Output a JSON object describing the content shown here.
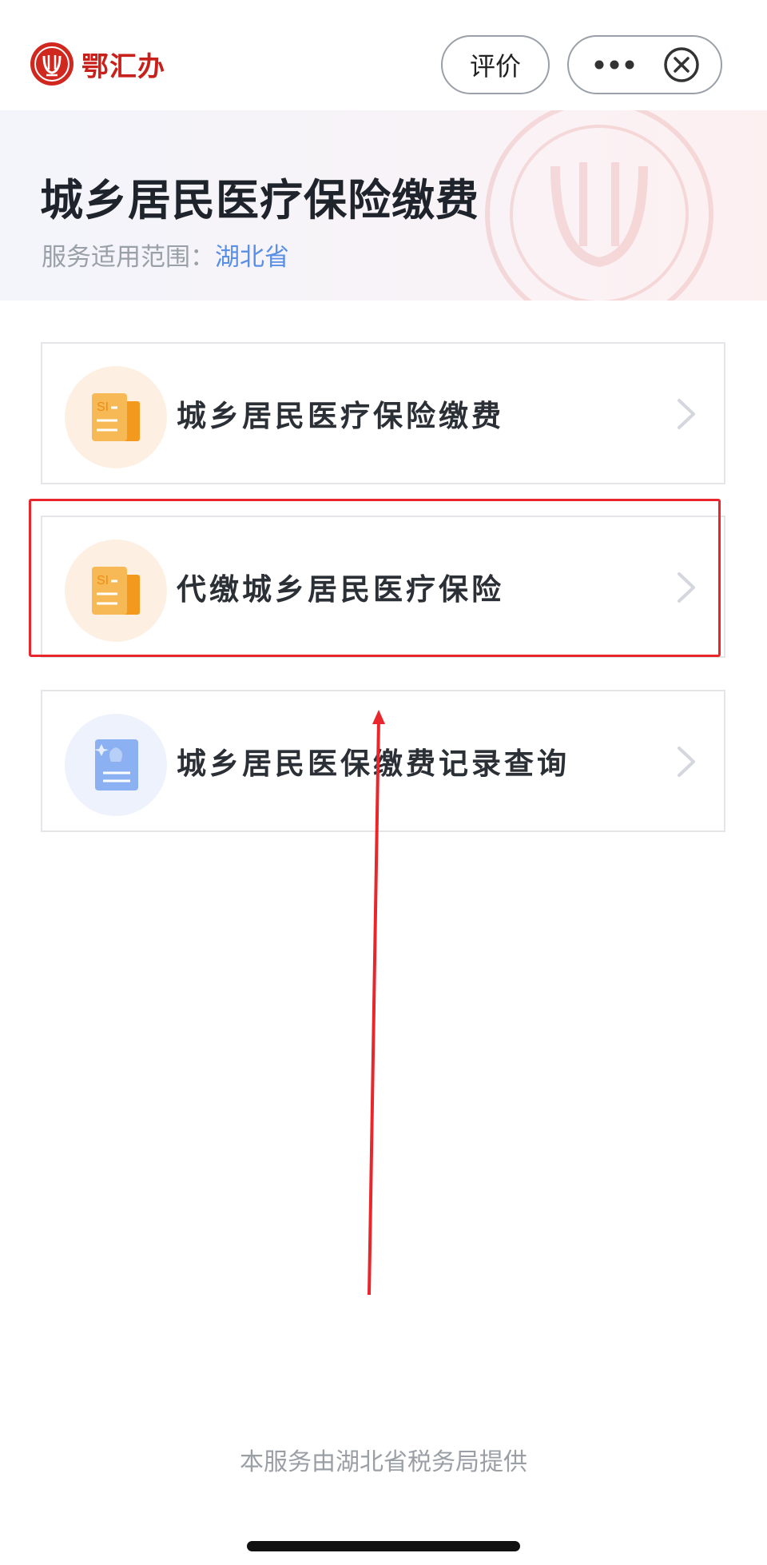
{
  "app": {
    "brand_name": "鄂汇办",
    "rate_label": "评价"
  },
  "header": {
    "title": "城乡居民医疗保险缴费",
    "scope_label": "服务适用范围：",
    "scope_value": "湖北省"
  },
  "services": [
    {
      "label": "城乡居民医疗保险缴费",
      "icon": "document-si-icon",
      "icon_text": "SI"
    },
    {
      "label": "代缴城乡居民医疗保险",
      "icon": "document-si-icon",
      "icon_text": "SI"
    },
    {
      "label": "城乡居民医保缴费记录查询",
      "icon": "record-query-icon"
    }
  ],
  "footer": {
    "note": "本服务由湖北省税务局提供"
  },
  "colors": {
    "brand_red": "#c8211b",
    "scope_blue": "#5a8fe6",
    "annotation_red": "#e8262b",
    "orange_icon": "#f5a83a",
    "blue_icon": "#7fa8f0"
  }
}
